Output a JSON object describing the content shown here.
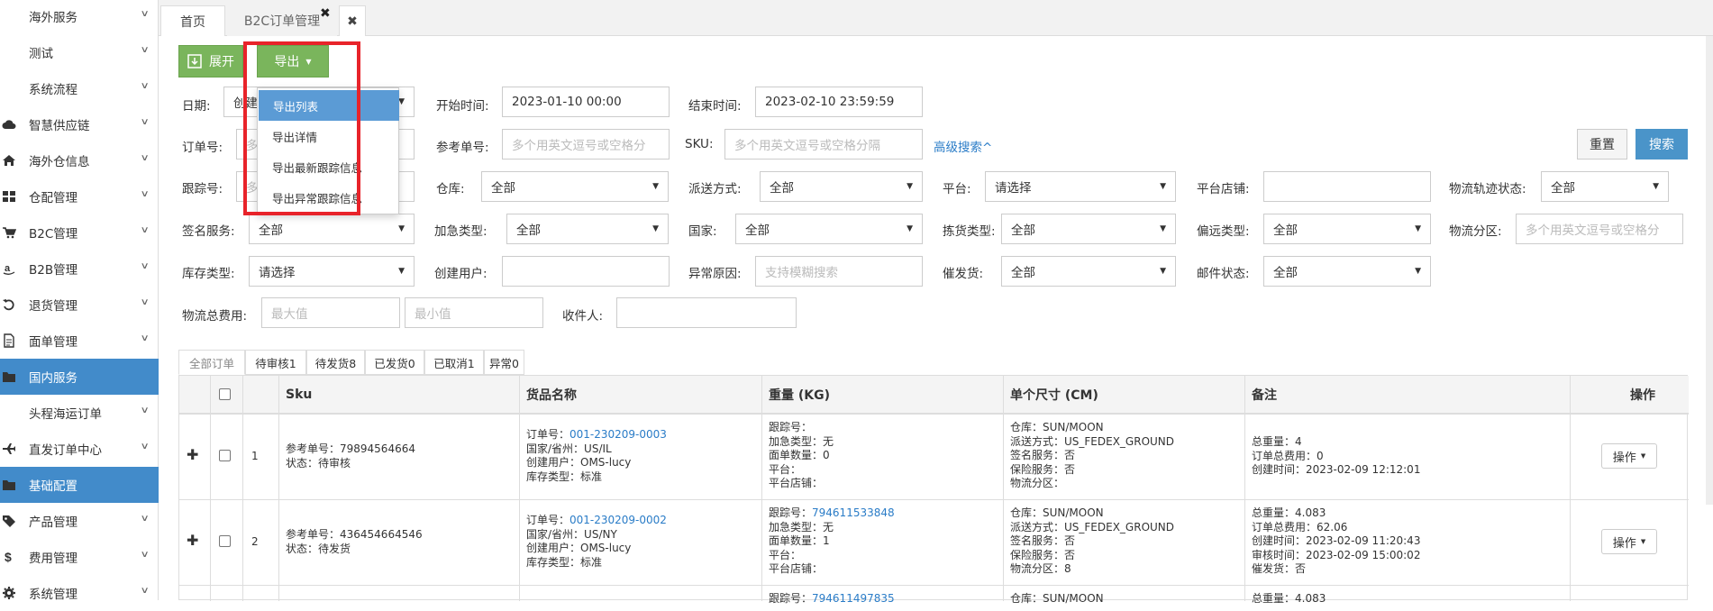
{
  "sidebar": {
    "items": [
      {
        "label": "海外服务",
        "icon": "",
        "active": false
      },
      {
        "label": "测试",
        "icon": "",
        "active": false
      },
      {
        "label": "系统流程",
        "icon": "",
        "active": false
      },
      {
        "label": "智慧供应链",
        "icon": "cloud-icon",
        "active": false
      },
      {
        "label": "海外仓信息",
        "icon": "home-icon",
        "active": false
      },
      {
        "label": "仓配管理",
        "icon": "grid-icon",
        "active": false
      },
      {
        "label": "B2C管理",
        "icon": "cart-icon",
        "active": false
      },
      {
        "label": "B2B管理",
        "icon": "amazon-icon",
        "active": false
      },
      {
        "label": "退货管理",
        "icon": "undo-icon",
        "active": false
      },
      {
        "label": "面单管理",
        "icon": "file-icon",
        "active": false
      },
      {
        "label": "国内服务",
        "icon": "folder-icon",
        "active": true
      },
      {
        "label": "头程海运订单",
        "icon": "",
        "active": false
      },
      {
        "label": "直发订单中心",
        "icon": "plane-icon",
        "active": false
      },
      {
        "label": "基础配置",
        "icon": "folder-icon",
        "active": true
      },
      {
        "label": "产品管理",
        "icon": "tag-icon",
        "active": false
      },
      {
        "label": "费用管理",
        "icon": "dollar-icon",
        "active": false
      },
      {
        "label": "系统管理",
        "icon": "gear-icon",
        "active": false
      }
    ]
  },
  "tabs": {
    "home": "首页",
    "b2c": "B2C订单管理",
    "close_symbol": "✖"
  },
  "toolbar": {
    "expand": "展开",
    "export": "导出"
  },
  "export_menu": [
    "导出列表",
    "导出详情",
    "导出最新跟踪信息",
    "导出异常跟踪信息"
  ],
  "filters": {
    "date_label": "日期:",
    "date_value": "创建",
    "start_label": "开始时间:",
    "start_value": "2023-01-10 00:00",
    "end_label": "结束时间:",
    "end_value": "2023-02-10 23:59:59",
    "order_no_label": "订单号:",
    "order_no_ph": "多",
    "ref_no_label": "参考单号:",
    "ref_no_ph": "多个用英文逗号或空格分",
    "sku_label": "SKU:",
    "sku_ph": "多个用英文逗号或空格分隔",
    "advanced": "高级搜索^",
    "reset": "重置",
    "search": "搜索",
    "track_label": "跟踪号:",
    "track_ph": "多",
    "warehouse_label": "仓库:",
    "warehouse_value": "全部",
    "delivery_label": "派送方式:",
    "delivery_value": "全部",
    "platform_label": "平台:",
    "platform_value": "请选择",
    "shop_label": "平台店铺:",
    "logistics_status_label": "物流轨迹状态:",
    "logistics_status_value": "全部",
    "sign_label": "签名服务:",
    "sign_value": "全部",
    "urgent_label": "加急类型:",
    "urgent_value": "全部",
    "country_label": "国家:",
    "country_value": "全部",
    "pick_label": "拣货类型:",
    "pick_value": "全部",
    "remote_label": "偏远类型:",
    "remote_value": "全部",
    "zone_label": "物流分区:",
    "zone_ph": "多个用英文逗号或空格分",
    "stock_label": "库存类型:",
    "stock_value": "请选择",
    "creator_label": "创建用户:",
    "exception_label": "异常原因:",
    "exception_ph": "支持模糊搜索",
    "urge_label": "催发货:",
    "urge_value": "全部",
    "mail_label": "邮件状态:",
    "mail_value": "全部",
    "fee_label": "物流总费用:",
    "fee_max_ph": "最大值",
    "fee_min_ph": "最小值",
    "receiver_label": "收件人:"
  },
  "status_tabs": [
    "全部订单",
    "待审核1",
    "待发货8",
    "已发货0",
    "已取消1",
    "异常0"
  ],
  "table": {
    "headers": {
      "sku": "Sku",
      "goods": "货品名称",
      "weight": "重量 (KG)",
      "size": "单个尺寸 (CM)",
      "remark": "备注",
      "ops": "操作"
    },
    "rows": [
      {
        "num": "1",
        "sku": [
          "参考单号：79894564664",
          "状态：待审核"
        ],
        "order_label": "订单号：",
        "order_no": "001-230209-0003",
        "goods": [
          "国家/省州：US/IL",
          "创建用户：OMS-lucy",
          "库存类型：标准"
        ],
        "track_label": "跟踪号：",
        "track_no": "",
        "weight": [
          "加急类型：无",
          "面单数量：0",
          "平台：",
          "平台店铺："
        ],
        "size": [
          "仓库：SUN/MOON",
          "派送方式：US_FEDEX_GROUND",
          "签名服务：否",
          "保险服务：否",
          "物流分区："
        ],
        "remark": [
          "总重量：4",
          "订单总费用：0",
          "创建时间：2023-02-09 12:12:01"
        ],
        "op": "操作"
      },
      {
        "num": "2",
        "sku": [
          "参考单号：436454664546",
          "状态：待发货"
        ],
        "order_label": "订单号：",
        "order_no": "001-230209-0002",
        "goods": [
          "国家/省州：US/NY",
          "创建用户：OMS-lucy",
          "库存类型：标准"
        ],
        "track_label": "跟踪号：",
        "track_no": "794611533848",
        "weight": [
          "加急类型：无",
          "面单数量：1",
          "平台：",
          "平台店铺："
        ],
        "size": [
          "仓库：SUN/MOON",
          "派送方式：US_FEDEX_GROUND",
          "签名服务：否",
          "保险服务：否",
          "物流分区：8"
        ],
        "remark": [
          "总重量：4.083",
          "订单总费用：62.06",
          "创建时间：2023-02-09 11:20:43",
          "审核时间：2023-02-09 15:00:02",
          "催发货：否"
        ],
        "op": "操作"
      },
      {
        "num": "",
        "track_label": "跟踪号：",
        "track_no": "794611497835",
        "size_first": "仓库：SUN/MOON",
        "remark_first": "总重量：4.083"
      }
    ]
  }
}
